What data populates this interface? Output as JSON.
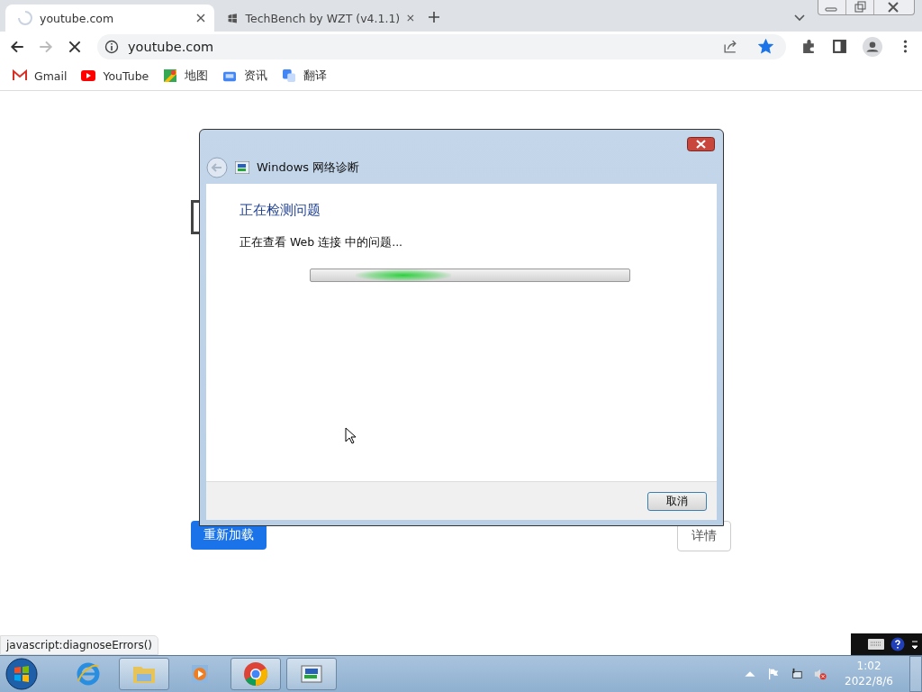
{
  "tabs": [
    {
      "title": "youtube.com",
      "selected": true,
      "loading": true
    },
    {
      "title": "TechBench by WZT (v4.1.1)",
      "selected": false,
      "loading": false
    }
  ],
  "address_bar": {
    "url": "youtube.com",
    "bookmarked": true
  },
  "bookmarks": [
    {
      "label": "Gmail",
      "kind": "gmail"
    },
    {
      "label": "YouTube",
      "kind": "youtube"
    },
    {
      "label": "地图",
      "kind": "maps"
    },
    {
      "label": "资讯",
      "kind": "news"
    },
    {
      "label": "翻译",
      "kind": "translate"
    }
  ],
  "page": {
    "reload_button": "重新加载",
    "details_button": "详情"
  },
  "dialog": {
    "title": "Windows 网络诊断",
    "heading": "正在检测问题",
    "message": "正在查看 Web 连接 中的问题...",
    "progress": {
      "level": 0.3
    },
    "cancel_button": "取消"
  },
  "status_bubble": "javascript:diagnoseErrors()",
  "taskbar": {
    "apps": [
      {
        "kind": "ie",
        "active": false
      },
      {
        "kind": "explorer",
        "active": true
      },
      {
        "kind": "media",
        "active": false
      },
      {
        "kind": "chrome",
        "active": true
      },
      {
        "kind": "network",
        "active": true
      }
    ],
    "time": "1:02",
    "date": "2022/8/6"
  }
}
